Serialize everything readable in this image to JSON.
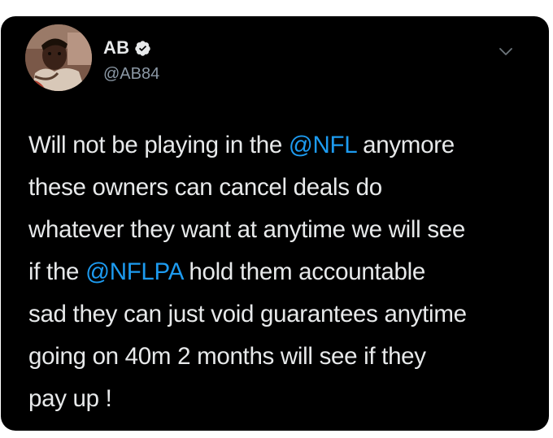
{
  "tweet": {
    "author": {
      "display_name": "AB",
      "handle": "@AB84",
      "verified": true,
      "avatar_icon": "profile-photo"
    },
    "menu_icon": "chevron-down-icon",
    "colors": {
      "background": "#000000",
      "text": "#e7e9ea",
      "secondary": "#8b98a5",
      "accent": "#1d9bf0"
    },
    "lines": [
      {
        "segments": [
          {
            "text": "Will not be playing in the ",
            "type": "text"
          },
          {
            "text": "@NFL",
            "type": "mention"
          },
          {
            "text": " anymore",
            "type": "text"
          }
        ]
      },
      {
        "segments": [
          {
            "text": "these owners can cancel deals do",
            "type": "text"
          }
        ]
      },
      {
        "segments": [
          {
            "text": "whatever they want at anytime we will see",
            "type": "text"
          }
        ]
      },
      {
        "segments": [
          {
            "text": "if the ",
            "type": "text"
          },
          {
            "text": "@NFLPA",
            "type": "mention"
          },
          {
            "text": " hold them accountable",
            "type": "text"
          }
        ]
      },
      {
        "segments": [
          {
            "text": "sad they can just void guarantees anytime",
            "type": "text"
          }
        ]
      },
      {
        "segments": [
          {
            "text": "going on 40m 2 months will see if they",
            "type": "text"
          }
        ]
      },
      {
        "segments": [
          {
            "text": "pay up !",
            "type": "text"
          }
        ]
      }
    ]
  }
}
